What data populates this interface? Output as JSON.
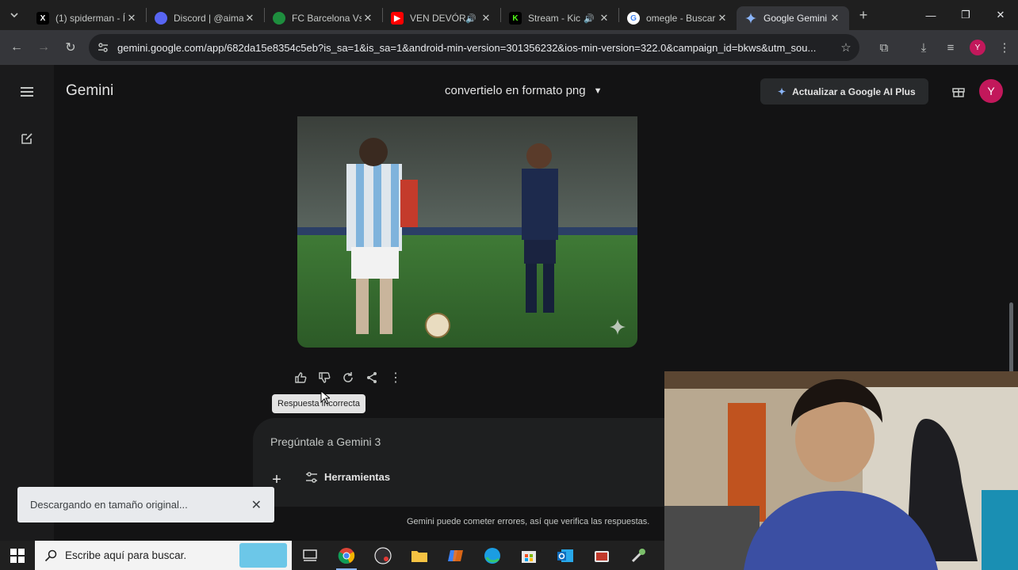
{
  "browser": {
    "tabs": [
      {
        "title": "(1) spiderman - Í",
        "favicon": "x-icon",
        "color": "#000000",
        "audio": false
      },
      {
        "title": "Discord | @aima",
        "favicon": "discord-icon",
        "color": "#5865f2",
        "audio": false
      },
      {
        "title": "FC Barcelona Vs",
        "favicon": "green-icon",
        "color": "#1e8e3e",
        "audio": false
      },
      {
        "title": "VEN DEVÓR",
        "favicon": "youtube-icon",
        "color": "#ff0000",
        "audio": true
      },
      {
        "title": "Stream - Kic",
        "favicon": "kick-icon",
        "color": "#53fc18",
        "audio": true
      },
      {
        "title": "omegle - Buscar",
        "favicon": "google-icon",
        "color": "#ffffff",
        "audio": false
      },
      {
        "title": "Google Gemini",
        "favicon": "gemini-icon",
        "color": "#8ab4f8",
        "audio": false,
        "active": true
      }
    ],
    "url": "gemini.google.com/app/682da15e8354c5eb?is_sa=1&is_sa=1&android-min-version=301356232&ios-min-version=322.0&campaign_id=bkws&utm_sou...",
    "profile_initial": "Y"
  },
  "app": {
    "brand": "Gemini",
    "chat_title": "convertielo en formato png",
    "upgrade_label": "Actualizar a Google AI Plus",
    "avatar_initial": "Y",
    "accent": "#c2185b"
  },
  "response": {
    "tooltip": "Respuesta incorrecta"
  },
  "prompt": {
    "placeholder": "Pregúntale a Gemini 3",
    "tools_label": "Herramientas",
    "disclaimer": "Gemini puede cometer errores, así que verifica las respuestas."
  },
  "download": {
    "message": "Descargando en tamaño original..."
  },
  "taskbar": {
    "search_placeholder": "Escribe aquí para buscar."
  }
}
